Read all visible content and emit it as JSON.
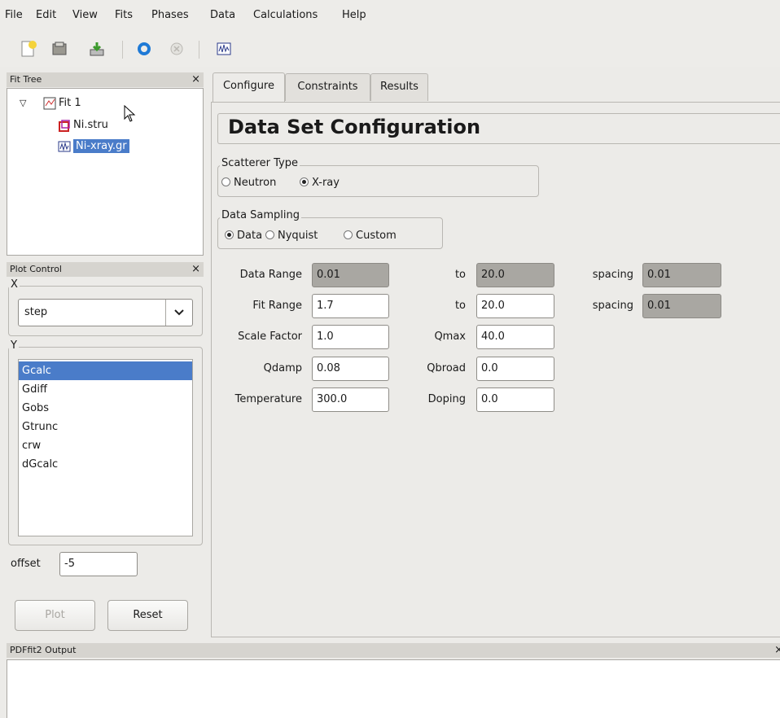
{
  "menu": [
    "File",
    "Edit",
    "View",
    "Fits",
    "Phases",
    "Data",
    "Calculations",
    "Help"
  ],
  "toolbar_icons": [
    "new-icon",
    "open-icon",
    "save-icon",
    "refresh-icon",
    "stop-icon",
    "data-plot-icon"
  ],
  "fit_tree": {
    "title": "Fit Tree",
    "close": "×",
    "root": "Fit 1",
    "children": [
      "Ni.stru",
      "Ni-xray.gr"
    ]
  },
  "plot_control": {
    "title": "Plot Control",
    "close": "×",
    "x_label": "X",
    "x_selected": "step",
    "y_label": "Y",
    "y_items": [
      "Gcalc",
      "Gdiff",
      "Gobs",
      "Gtrunc",
      "crw",
      "dGcalc"
    ],
    "y_selected_index": 0,
    "offset_label": "offset",
    "offset_value": "-5",
    "plot_label": "Plot",
    "reset_label": "Reset"
  },
  "tabs": [
    "Configure",
    "Constraints",
    "Results"
  ],
  "active_tab": "Configure",
  "config": {
    "heading": "Data Set Configuration",
    "scatterer_title": "Scatterer Type",
    "scatterer_options": [
      "Neutron",
      "X-ray"
    ],
    "scatterer_selected": "X-ray",
    "sampling_title": "Data Sampling",
    "sampling_options": [
      "Data",
      "Nyquist",
      "Custom"
    ],
    "sampling_selected": "Data",
    "data_range": {
      "label": "Data Range",
      "from": "0.01",
      "to_label": "to",
      "to": "20.0",
      "spacing_label": "spacing",
      "spacing": "0.01"
    },
    "fit_range": {
      "label": "Fit Range",
      "from": "1.7",
      "to_label": "to",
      "to": "20.0",
      "spacing_label": "spacing",
      "spacing": "0.01"
    },
    "scale_factor": {
      "label": "Scale Factor",
      "value": "1.0"
    },
    "qmax": {
      "label": "Qmax",
      "value": "40.0"
    },
    "qdamp": {
      "label": "Qdamp",
      "value": "0.08"
    },
    "qbroad": {
      "label": "Qbroad",
      "value": "0.0"
    },
    "temperature": {
      "label": "Temperature",
      "value": "300.0"
    },
    "doping": {
      "label": "Doping",
      "value": "0.0"
    }
  },
  "output": {
    "title": "PDFfit2 Output",
    "close": "×",
    "text": ""
  }
}
